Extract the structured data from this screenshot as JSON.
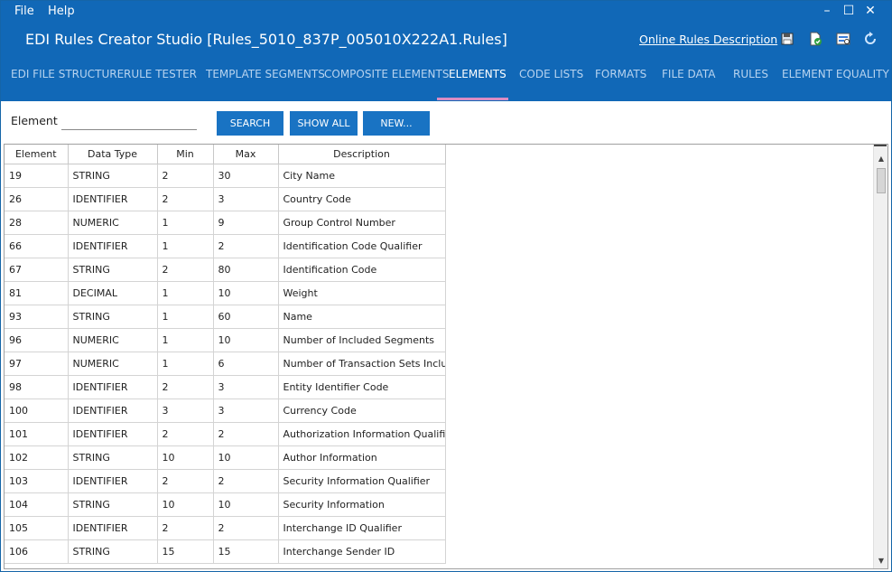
{
  "menu": {
    "file": "File",
    "help": "Help"
  },
  "window_controls": {
    "minimize": "–",
    "maximize": "☐",
    "close": "✕"
  },
  "title": "EDI Rules Creator Studio [Rules_5010_837P_005010X222A1.Rules]",
  "online_link": "Online Rules Description",
  "toolbar_icons": [
    "save-icon",
    "validate-icon",
    "export-icon",
    "refresh-icon"
  ],
  "tabs": [
    {
      "label": "EDI FILE STRUCTURE",
      "active": false
    },
    {
      "label": "RULE TESTER",
      "active": false
    },
    {
      "label": "TEMPLATE SEGMENTS",
      "active": false
    },
    {
      "label": "COMPOSITE ELEMENTS",
      "active": false
    },
    {
      "label": "ELEMENTS",
      "active": true
    },
    {
      "label": "CODE LISTS",
      "active": false
    },
    {
      "label": "FORMATS",
      "active": false
    },
    {
      "label": "FILE DATA",
      "active": false
    },
    {
      "label": "RULES",
      "active": false
    },
    {
      "label": "ELEMENT EQUALITY",
      "active": false
    }
  ],
  "search": {
    "label": "Element",
    "value": "",
    "search_button": "SEARCH",
    "show_all_button": "SHOW ALL",
    "new_button": "NEW..."
  },
  "grid": {
    "columns": [
      "Element",
      "Data Type",
      "Min",
      "Max",
      "Description"
    ],
    "rows": [
      [
        "19",
        "STRING",
        "2",
        "30",
        "City Name"
      ],
      [
        "26",
        "IDENTIFIER",
        "2",
        "3",
        "Country Code"
      ],
      [
        "28",
        "NUMERIC",
        "1",
        "9",
        "Group Control Number"
      ],
      [
        "66",
        "IDENTIFIER",
        "1",
        "2",
        "Identification Code Qualifier"
      ],
      [
        "67",
        "STRING",
        "2",
        "80",
        "Identification Code"
      ],
      [
        "81",
        "DECIMAL",
        "1",
        "10",
        "Weight"
      ],
      [
        "93",
        "STRING",
        "1",
        "60",
        "Name"
      ],
      [
        "96",
        "NUMERIC",
        "1",
        "10",
        "Number of Included Segments"
      ],
      [
        "97",
        "NUMERIC",
        "1",
        "6",
        "Number of Transaction Sets Includ"
      ],
      [
        "98",
        "IDENTIFIER",
        "2",
        "3",
        "Entity Identifier Code"
      ],
      [
        "100",
        "IDENTIFIER",
        "3",
        "3",
        "Currency Code"
      ],
      [
        "101",
        "IDENTIFIER",
        "2",
        "2",
        "Authorization Information Qualifier"
      ],
      [
        "102",
        "STRING",
        "10",
        "10",
        "Author Information"
      ],
      [
        "103",
        "IDENTIFIER",
        "2",
        "2",
        "Security Information Qualifier"
      ],
      [
        "104",
        "STRING",
        "10",
        "10",
        "Security Information"
      ],
      [
        "105",
        "IDENTIFIER",
        "2",
        "2",
        "Interchange ID Qualifier"
      ],
      [
        "106",
        "STRING",
        "15",
        "15",
        "Interchange Sender ID"
      ]
    ]
  },
  "colors": {
    "header_bg": "#1168b7",
    "button_bg": "#1973c3",
    "active_tab_underline": "#d98cc3"
  }
}
